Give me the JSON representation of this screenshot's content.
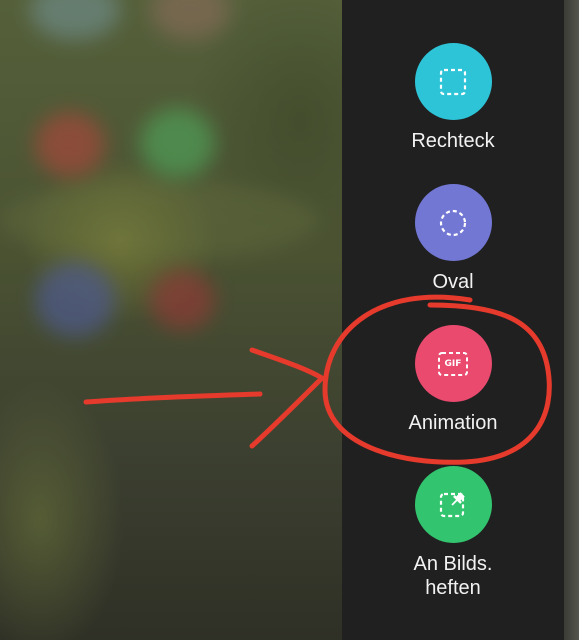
{
  "colors": {
    "panel": "#202020",
    "rect_accent": "#2ec4d8",
    "oval_accent": "#7277d4",
    "animation_accent": "#e94a6e",
    "pin_accent": "#32c46e",
    "annotation": "#e53a2c"
  },
  "menu": {
    "items": [
      {
        "label": "Rechteck",
        "icon": "dashed-square-icon"
      },
      {
        "label": "Oval",
        "icon": "dashed-circle-icon"
      },
      {
        "label": "Animation",
        "icon": "gif-icon",
        "icon_text": "GIF"
      },
      {
        "label_line1": "An Bilds.",
        "label_line2": "heften",
        "icon": "pin-icon"
      }
    ]
  }
}
